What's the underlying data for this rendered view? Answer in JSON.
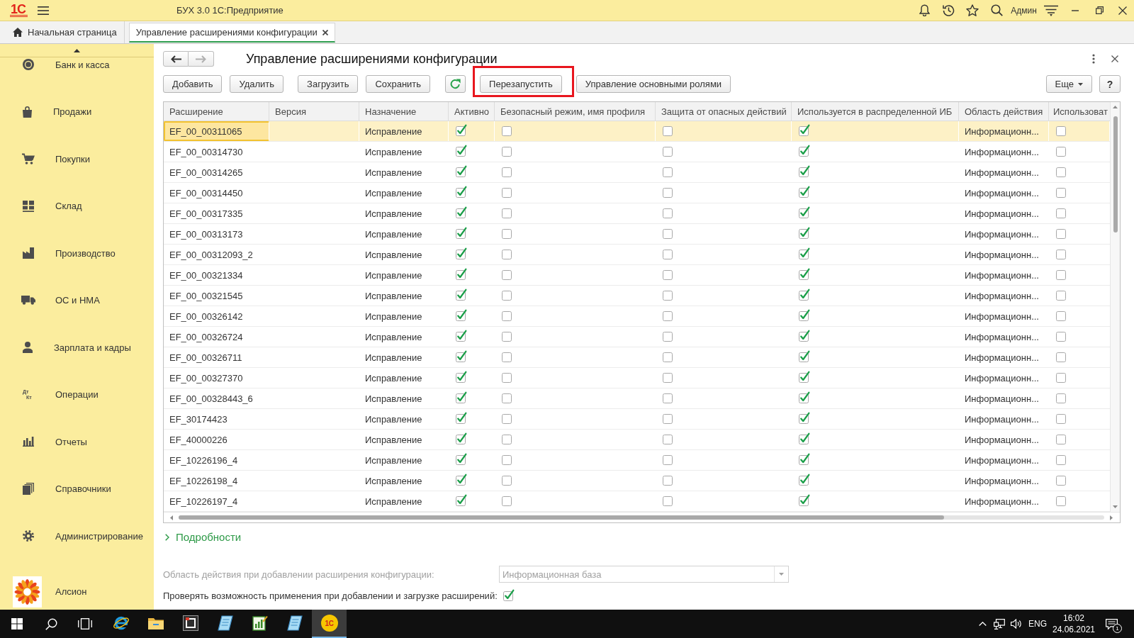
{
  "titlebar": {
    "logo": "1С",
    "title": "БУХ 3.0 1С:Предприятие",
    "user": "Админ"
  },
  "tabs": [
    {
      "label": "Начальная страница",
      "kind": "home",
      "selected": false
    },
    {
      "label": "Управление расширениями конфигурации",
      "kind": "form",
      "selected": true
    }
  ],
  "sidebar": {
    "items": [
      {
        "label": "Банк и касса",
        "kind": "coin"
      },
      {
        "label": "Продажи",
        "kind": "bag"
      },
      {
        "label": "Покупки",
        "kind": "cart"
      },
      {
        "label": "Склад",
        "kind": "warehouse"
      },
      {
        "label": "Производство",
        "kind": "factory"
      },
      {
        "label": "ОС и НМА",
        "kind": "truck"
      },
      {
        "label": "Зарплата и кадры",
        "kind": "person"
      },
      {
        "label": "Операции",
        "kind": "ledger",
        "icon_text": [
          "Дт",
          "Кт"
        ]
      },
      {
        "label": "Отчеты",
        "kind": "chart"
      },
      {
        "label": "Справочники",
        "kind": "books"
      },
      {
        "label": "Администрирование",
        "kind": "gear"
      },
      {
        "label": "Алсион",
        "kind": "logo"
      }
    ]
  },
  "form": {
    "title": "Управление расширениями конфигурации",
    "navigation": {
      "back_enabled": true,
      "forward_enabled": false
    },
    "buttons": [
      {
        "kind": "text",
        "label": "Добавить",
        "highlighted": false
      },
      {
        "kind": "text",
        "label": "Удалить",
        "highlighted": false
      },
      {
        "kind": "text",
        "label": "Загрузить",
        "highlighted": false
      },
      {
        "kind": "text",
        "label": "Сохранить",
        "highlighted": false
      },
      {
        "kind": "refresh",
        "highlighted": false
      },
      {
        "kind": "text",
        "label": "Перезапустить",
        "highlighted": true
      },
      {
        "kind": "text",
        "label": "Управление основными ролями",
        "highlighted": false
      }
    ],
    "right_buttons": [
      {
        "kind": "menu",
        "label": "Еще"
      },
      {
        "kind": "help",
        "label": "?"
      }
    ]
  },
  "table": {
    "columns": [
      "Расширение",
      "Версия",
      "Назначение",
      "Активно",
      "Безопасный режим, имя профиля",
      "Защита от опасных действий",
      "Используется в распределенной ИБ",
      "Область действия",
      "Использоват"
    ],
    "rows": [
      {
        "name": "EF_00_00311065",
        "purpose": "Исправление",
        "active": true,
        "safe_mode": false,
        "protection": false,
        "distributed": true,
        "scope": "Информационн...",
        "use": false,
        "selected": true
      },
      {
        "name": "EF_00_00314730",
        "purpose": "Исправление",
        "active": true,
        "safe_mode": false,
        "protection": false,
        "distributed": true,
        "scope": "Информационн...",
        "use": false,
        "selected": false
      },
      {
        "name": "EF_00_00314265",
        "purpose": "Исправление",
        "active": true,
        "safe_mode": false,
        "protection": false,
        "distributed": true,
        "scope": "Информационн...",
        "use": false,
        "selected": false
      },
      {
        "name": "EF_00_00314450",
        "purpose": "Исправление",
        "active": true,
        "safe_mode": false,
        "protection": false,
        "distributed": true,
        "scope": "Информационн...",
        "use": false,
        "selected": false
      },
      {
        "name": "EF_00_00317335",
        "purpose": "Исправление",
        "active": true,
        "safe_mode": false,
        "protection": false,
        "distributed": true,
        "scope": "Информационн...",
        "use": false,
        "selected": false
      },
      {
        "name": "EF_00_00313173",
        "purpose": "Исправление",
        "active": true,
        "safe_mode": false,
        "protection": false,
        "distributed": true,
        "scope": "Информационн...",
        "use": false,
        "selected": false
      },
      {
        "name": "EF_00_00312093_2",
        "purpose": "Исправление",
        "active": true,
        "safe_mode": false,
        "protection": false,
        "distributed": true,
        "scope": "Информационн...",
        "use": false,
        "selected": false
      },
      {
        "name": "EF_00_00321334",
        "purpose": "Исправление",
        "active": true,
        "safe_mode": false,
        "protection": false,
        "distributed": true,
        "scope": "Информационн...",
        "use": false,
        "selected": false
      },
      {
        "name": "EF_00_00321545",
        "purpose": "Исправление",
        "active": true,
        "safe_mode": false,
        "protection": false,
        "distributed": true,
        "scope": "Информационн...",
        "use": false,
        "selected": false
      },
      {
        "name": "EF_00_00326142",
        "purpose": "Исправление",
        "active": true,
        "safe_mode": false,
        "protection": false,
        "distributed": true,
        "scope": "Информационн...",
        "use": false,
        "selected": false
      },
      {
        "name": "EF_00_00326724",
        "purpose": "Исправление",
        "active": true,
        "safe_mode": false,
        "protection": false,
        "distributed": true,
        "scope": "Информационн...",
        "use": false,
        "selected": false
      },
      {
        "name": "EF_00_00326711",
        "purpose": "Исправление",
        "active": true,
        "safe_mode": false,
        "protection": false,
        "distributed": true,
        "scope": "Информационн...",
        "use": false,
        "selected": false
      },
      {
        "name": "EF_00_00327370",
        "purpose": "Исправление",
        "active": true,
        "safe_mode": false,
        "protection": false,
        "distributed": true,
        "scope": "Информационн...",
        "use": false,
        "selected": false
      },
      {
        "name": "EF_00_00328443_6",
        "purpose": "Исправление",
        "active": true,
        "safe_mode": false,
        "protection": false,
        "distributed": true,
        "scope": "Информационн...",
        "use": false,
        "selected": false
      },
      {
        "name": "EF_30174423",
        "purpose": "Исправление",
        "active": true,
        "safe_mode": false,
        "protection": false,
        "distributed": true,
        "scope": "Информационн...",
        "use": false,
        "selected": false
      },
      {
        "name": "EF_40000226",
        "purpose": "Исправление",
        "active": true,
        "safe_mode": false,
        "protection": false,
        "distributed": true,
        "scope": "Информационн...",
        "use": false,
        "selected": false
      },
      {
        "name": "EF_10226196_4",
        "purpose": "Исправление",
        "active": true,
        "safe_mode": false,
        "protection": false,
        "distributed": true,
        "scope": "Информационн...",
        "use": false,
        "selected": false
      },
      {
        "name": "EF_10226198_4",
        "purpose": "Исправление",
        "active": true,
        "safe_mode": false,
        "protection": false,
        "distributed": true,
        "scope": "Информационн...",
        "use": false,
        "selected": false
      },
      {
        "name": "EF_10226197_4",
        "purpose": "Исправление",
        "active": true,
        "safe_mode": false,
        "protection": false,
        "distributed": true,
        "scope": "Информационн...",
        "use": false,
        "selected": false
      }
    ]
  },
  "details": {
    "label": "Подробности",
    "expanded": false
  },
  "settings": {
    "scope": {
      "label": "Область действия при добавлении расширения конфигурации:",
      "value": "Информационная база",
      "disabled": true
    },
    "check_on_add": {
      "label": "Проверять возможность применения при добавлении и загрузке расширений:",
      "checked": true
    }
  },
  "taskbar": {
    "apps": [
      {
        "kind": "browser",
        "selected": false
      },
      {
        "kind": "folder",
        "selected": false
      },
      {
        "kind": "tile",
        "selected": false
      },
      {
        "kind": "notebook",
        "selected": false
      },
      {
        "kind": "chart-doc",
        "selected": false
      },
      {
        "kind": "notebook",
        "selected": false
      },
      {
        "kind": "logo",
        "label": "1С",
        "selected": true
      }
    ],
    "language": "ENG",
    "time": "16:02",
    "date": "24.06.2021",
    "notifications": "1"
  }
}
